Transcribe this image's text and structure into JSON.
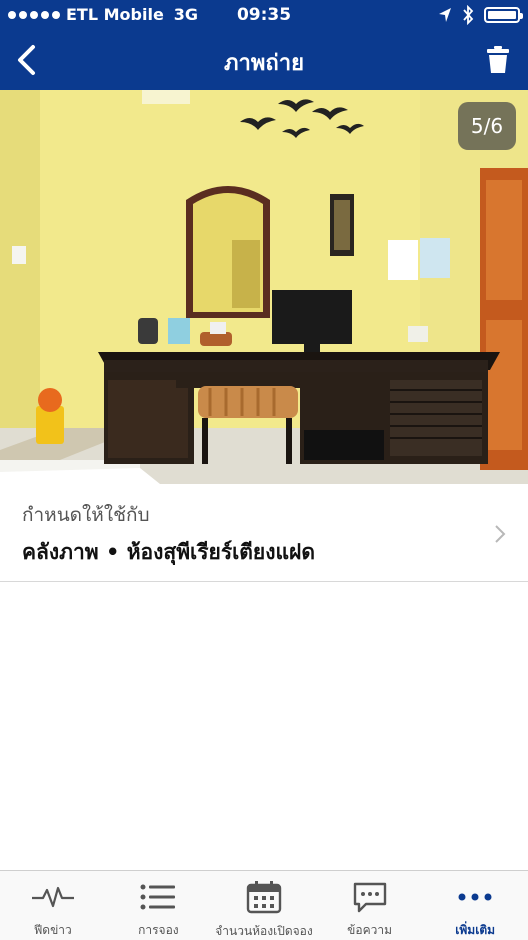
{
  "status_bar": {
    "carrier": "ETL Mobile",
    "network": "3G",
    "time": "09:35"
  },
  "nav": {
    "title": "ภาพถ่าย",
    "back_icon": "chevron-left-icon",
    "delete_icon": "trash-icon"
  },
  "photo": {
    "counter": "5/6"
  },
  "assign": {
    "label": "กำหนดให้ใช้กับ",
    "value": "คลังภาพ • ห้องสุพีเรียร์เตียงแฝด"
  },
  "tabs": [
    {
      "label": "ฟีดข่าว",
      "icon": "activity-icon",
      "active": false
    },
    {
      "label": "การจอง",
      "icon": "list-icon",
      "active": false
    },
    {
      "label": "จำนวนห้องเปิดจอง",
      "icon": "calendar-icon",
      "active": false
    },
    {
      "label": "ข้อความ",
      "icon": "message-icon",
      "active": false
    },
    {
      "label": "เพิ่มเติม",
      "icon": "more-icon",
      "active": true
    }
  ],
  "colors": {
    "brand": "#0b3a8f",
    "active_tab": "#0b3a8f",
    "inactive_tab": "#555555"
  }
}
